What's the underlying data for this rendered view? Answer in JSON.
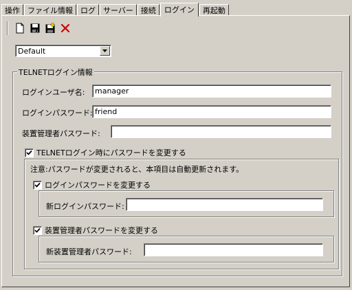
{
  "tabs": [
    {
      "label": "操作"
    },
    {
      "label": "ファイル情報"
    },
    {
      "label": "ログ"
    },
    {
      "label": "サーバー"
    },
    {
      "label": "接続"
    },
    {
      "label": "ログイン"
    },
    {
      "label": "再起動"
    }
  ],
  "toolbar": {
    "icons": [
      "new-file-icon",
      "save-icon",
      "save-as-icon",
      "delete-icon"
    ],
    "delete_color": "#cc0000"
  },
  "profile_select": {
    "value": "Default"
  },
  "telnet_group": {
    "title": "TELNETログイン情報",
    "login_user_label": "ログインユーザ名:",
    "login_user_value": "manager",
    "login_password_label": "ログインパスワード:",
    "login_password_value": "friend",
    "admin_password_label": "装置管理者パスワード:",
    "admin_password_value": "",
    "change_on_login_label": "TELNETログイン時にパスワードを変更する",
    "change_on_login_checked": true,
    "note": "注意:パスワードが変更されると、本項目は自動更新されます。",
    "change_login_pw_label": "ログインパスワードを変更する",
    "change_login_pw_checked": true,
    "new_login_pw_label": "新ログインパスワード:",
    "new_login_pw_value": "",
    "change_admin_pw_label": "装置管理者パスワードを変更する",
    "change_admin_pw_checked": true,
    "new_admin_pw_label": "新装置管理者パスワード:",
    "new_admin_pw_value": ""
  }
}
